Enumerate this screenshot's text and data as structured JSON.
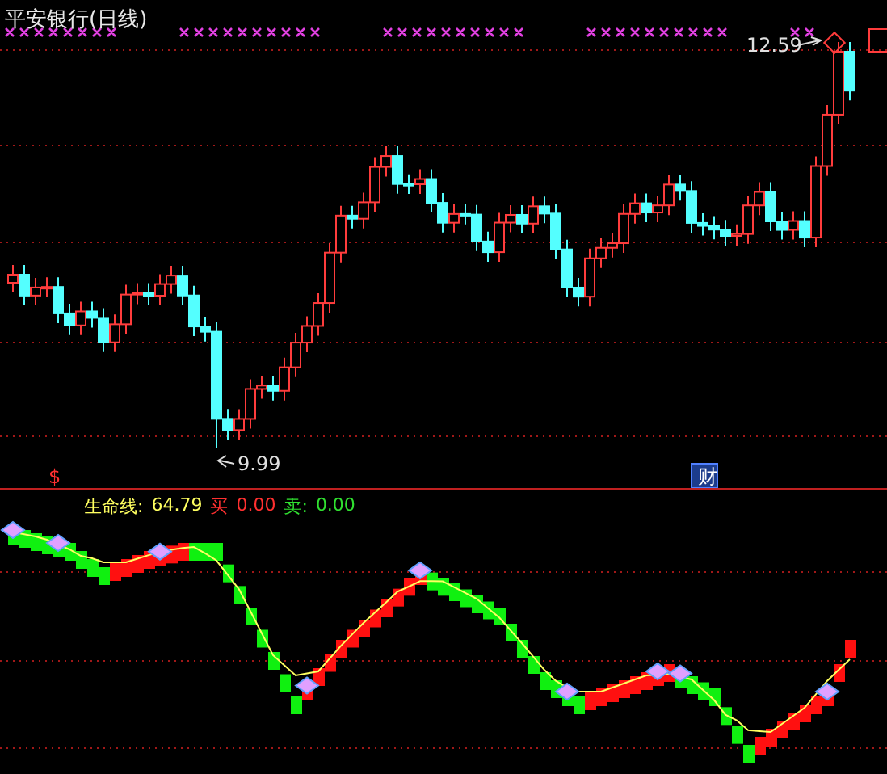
{
  "chart": {
    "title": "平安银行(日线)",
    "high_label": "12.59",
    "low_label": "9.99",
    "markers": [
      {
        "kind": "dividend",
        "text": "$"
      },
      {
        "kind": "finance",
        "text": "财"
      }
    ]
  },
  "indicator": {
    "name": "生命线:",
    "value": "64.79",
    "buy_label": "买",
    "buy_value": "0.00",
    "sell_label": "卖:",
    "sell_value": "0.00"
  }
}
